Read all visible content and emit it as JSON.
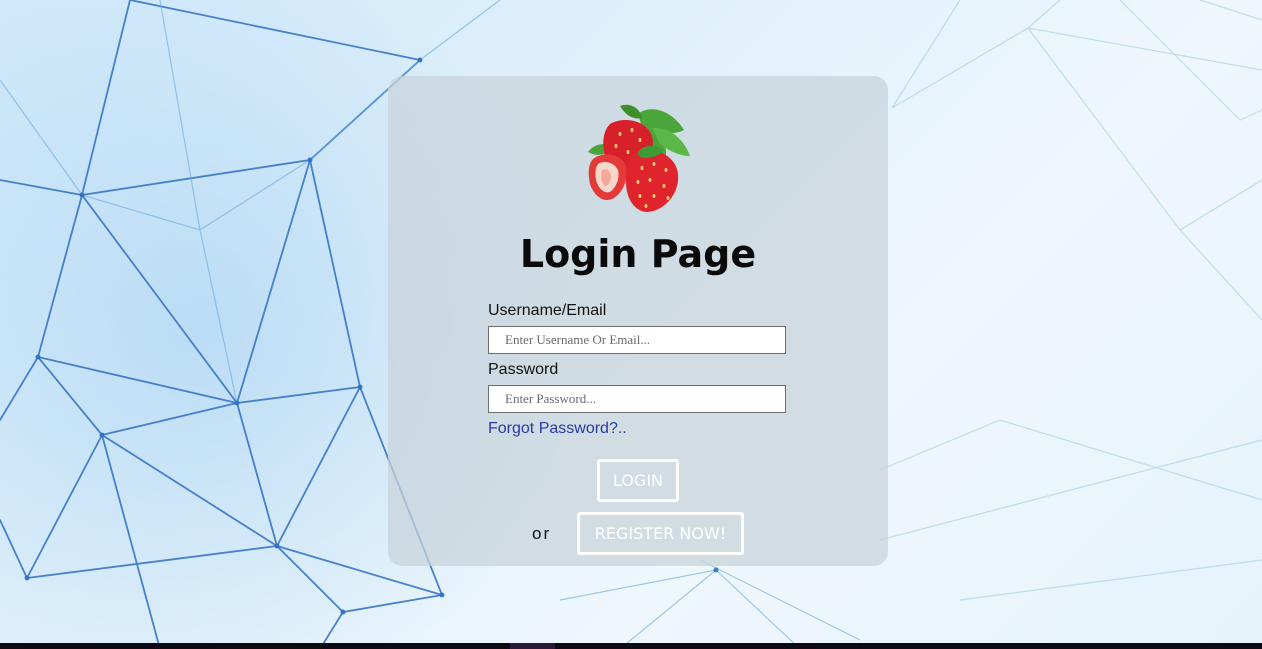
{
  "page": {
    "title": "Login Page"
  },
  "logo": {
    "icon": "strawberry-icon"
  },
  "form": {
    "username_label": "Username/Email",
    "username_placeholder": "Enter Username Or Email...",
    "password_label": "Password",
    "password_placeholder": "Enter Password...",
    "forgot_link": "Forgot Password?..",
    "login_button": "LOGIN",
    "or_text": "or",
    "register_button": "REGISTER NOW!"
  },
  "colors": {
    "link": "#2a3aa8",
    "button_border": "#ffffff",
    "card_bg": "rgba(200,210,218,0.72)"
  }
}
